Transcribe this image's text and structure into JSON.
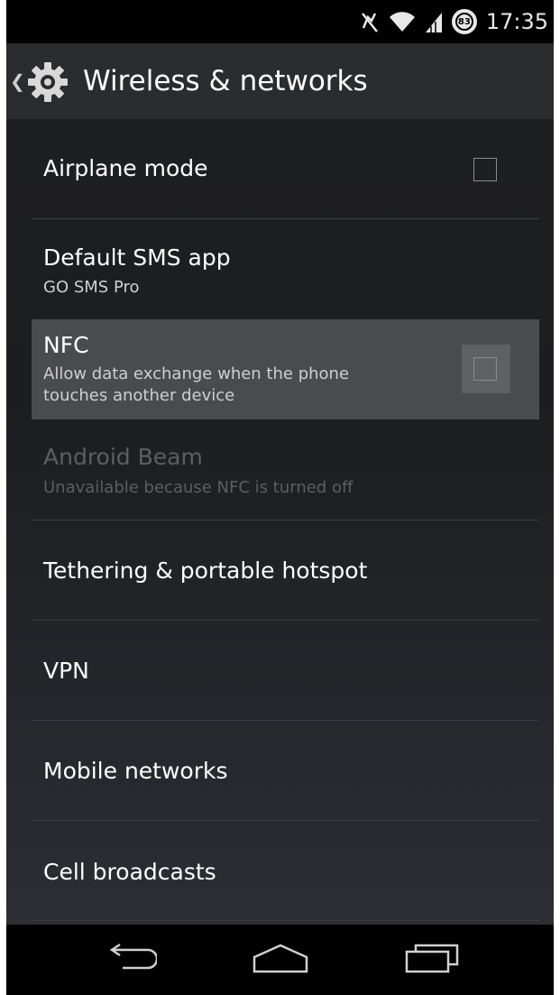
{
  "status_bar": {
    "time": "17:35",
    "battery_level": "83",
    "icons": [
      "mute-icon",
      "wifi-icon",
      "signal-icon",
      "battery-icon"
    ]
  },
  "action_bar": {
    "title": "Wireless & networks",
    "icon": "settings-gear-icon"
  },
  "settings": {
    "airplane_mode": {
      "title": "Airplane mode",
      "checked": false
    },
    "default_sms": {
      "title": "Default SMS app",
      "summary": "GO SMS Pro"
    },
    "nfc": {
      "title": "NFC",
      "summary_line1": "Allow data exchange when the phone",
      "summary_line2": "touches another device",
      "checked": false
    },
    "android_beam": {
      "title": "Android Beam",
      "summary": "Unavailable because NFC is turned off"
    },
    "tethering": {
      "title": "Tethering & portable hotspot"
    },
    "vpn": {
      "title": "VPN"
    },
    "mobile_networks": {
      "title": "Mobile networks"
    },
    "cell_broadcasts": {
      "title": "Cell broadcasts"
    }
  },
  "nav_bar": {
    "buttons": [
      "back-icon",
      "home-icon",
      "recents-icon"
    ]
  },
  "colors": {
    "background": "#1f2023",
    "action_bar": "#2b2c2f",
    "pressed_row": "#4a4b4f",
    "divider": "#3c3d41",
    "disabled_text": "#5d5e62"
  }
}
